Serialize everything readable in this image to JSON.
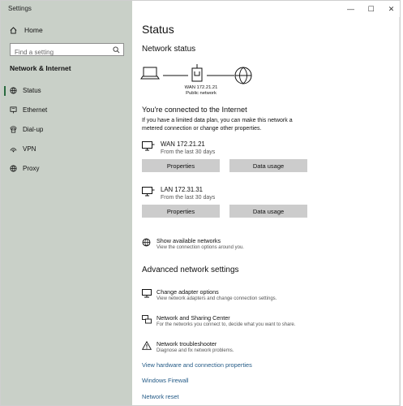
{
  "app_title": "Settings",
  "sidebar": {
    "home_label": "Home",
    "search_placeholder": "Find a setting",
    "section_title": "Network & Internet",
    "items": [
      {
        "label": "Status",
        "icon": "home-globe-icon",
        "active": true
      },
      {
        "label": "Ethernet",
        "icon": "ethernet-icon"
      },
      {
        "label": "Dial-up",
        "icon": "dialup-icon"
      },
      {
        "label": "VPN",
        "icon": "vpn-icon"
      },
      {
        "label": "Proxy",
        "icon": "globe-icon"
      }
    ]
  },
  "window_controls": {
    "minimize": "—",
    "maximize": "☐",
    "close": "✕"
  },
  "main": {
    "title": "Status",
    "network_status_heading": "Network status",
    "diagram": {
      "network_name": "WAN 172.21.21",
      "network_type": "Public network"
    },
    "connected_title": "You're connected to the Internet",
    "connected_desc": "If you have a limited data plan, you can make this network a metered connection or change other properties.",
    "connections": [
      {
        "name": "WAN 172.21.21",
        "sub": "From the last 30 days",
        "properties_label": "Properties",
        "data_usage_label": "Data usage"
      },
      {
        "name": "LAN 172.31.31",
        "sub": "From the last 30 days",
        "properties_label": "Properties",
        "data_usage_label": "Data usage"
      }
    ],
    "show_networks": {
      "name": "Show available networks",
      "sub": "View the connection options around you."
    },
    "advanced_heading": "Advanced network settings",
    "advanced_items": [
      {
        "name": "Change adapter options",
        "sub": "View network adapters and change connection settings.",
        "icon": "adapter-icon"
      },
      {
        "name": "Network and Sharing Center",
        "sub": "For the networks you connect to, decide what you want to share.",
        "icon": "sharing-icon"
      },
      {
        "name": "Network troubleshooter",
        "sub": "Diagnose and fix network problems.",
        "icon": "warning-icon"
      }
    ],
    "links": [
      "View hardware and connection properties",
      "Windows Firewall",
      "Network reset"
    ]
  }
}
